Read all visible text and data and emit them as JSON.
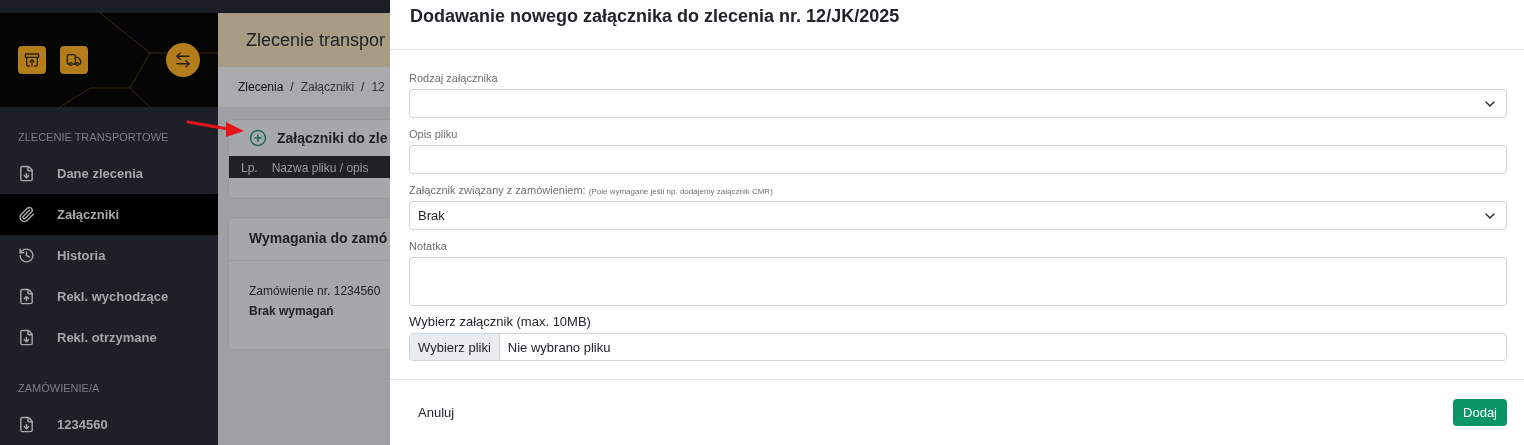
{
  "sidebar": {
    "sections": [
      {
        "heading": "ZLECENIE TRANSPORTOWE",
        "items": [
          {
            "label": "Dane zlecenia",
            "kind": "download",
            "selected": false
          },
          {
            "label": "Załączniki",
            "kind": "attachment",
            "selected": true
          },
          {
            "label": "Historia",
            "kind": "history",
            "selected": false
          },
          {
            "label": "Rekl. wychodzące",
            "kind": "upload",
            "selected": false
          },
          {
            "label": "Rekl. otrzymane",
            "kind": "download",
            "selected": false
          }
        ]
      },
      {
        "heading": "ZAMÓWIENIE/A",
        "items": [
          {
            "label": "1234560",
            "kind": "download",
            "selected": false
          }
        ]
      }
    ]
  },
  "main": {
    "title": "Zlecenie transpor",
    "breadcrumbs": [
      {
        "label": "Zlecenia"
      },
      {
        "separator": "/",
        "label": "Załączniki"
      },
      {
        "separator": "/",
        "label": "12"
      }
    ],
    "attachments_card": {
      "title": "Załączniki do zle",
      "columns": [
        "Lp.",
        "Nazwa pliku / opis"
      ]
    },
    "requirements_card": {
      "title": "Wymagania do zamó",
      "order": "Zamówienie nr. 1234560",
      "requirements": "Brak wymagań"
    }
  },
  "modal": {
    "title": "Dodawanie nowego załącznika do zlecenia nr. 12/JK/2025",
    "fields": [
      {
        "kind": "select",
        "label": "Rodzaj załącznika"
      },
      {
        "kind": "input",
        "label": "Opis pliku"
      },
      {
        "kind": "select",
        "label": "Załącznik związany z zamówieniem:",
        "hint": "(Pole wymagane jeśli np. dodajemy załącznik CMR)",
        "value": "Brak"
      },
      {
        "kind": "textarea",
        "label": "Notatka"
      },
      {
        "kind": "file",
        "label": "Wybierz załącznik (max. 10MB)",
        "button": "Wybierz pliki",
        "value": "Nie wybrano pliku"
      }
    ],
    "cancel": "Anuluj",
    "submit": "Dodaj"
  }
}
